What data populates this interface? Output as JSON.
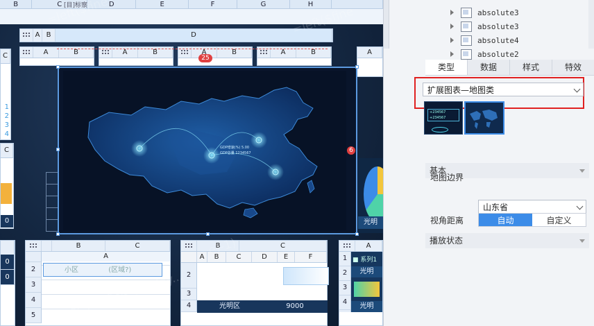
{
  "sheet": {
    "top_columns": [
      "B",
      "C",
      "D",
      "E",
      "F",
      "G",
      "H",
      ""
    ],
    "top_cell_text": "[目]标察",
    "formula_watermark_1": "=left($fine",
    "formula_watermark_2": "=left($fine",
    "formula_watermark_3": "=left($fine_",
    "formula_watermark_4": "e.find(\"[\",$fine_display...",
    "formula_watermark_5": "e)-1)",
    "formula_watermark_6": "display",
    "ab_header": [
      "A",
      "B"
    ],
    "d_header": "D",
    "mini_headers": [
      [
        "A",
        "B"
      ],
      [
        "A",
        "B"
      ],
      [
        "A",
        "B"
      ],
      [
        "A",
        "B"
      ]
    ],
    "badge_25": "25",
    "badge_6": "6",
    "left_col_c": "C",
    "left_rows": [
      "1",
      "2",
      "3",
      "4"
    ],
    "left_col_c2": "C",
    "left_val_0": "0",
    "side_right_a": "A",
    "bottom_left_rows": [
      "2",
      "3",
      "4",
      "5"
    ],
    "bottom_left_vals": [
      "0",
      "0"
    ],
    "sheet2": {
      "cols": [
        "A",
        "B",
        "C"
      ],
      "rows": [
        "2",
        "3",
        "4",
        "5"
      ],
      "cell_text": "小区",
      "cell_text_2": "(区域?)"
    },
    "sheet3": {
      "cols_top": [
        "B",
        "C"
      ],
      "cols": [
        "A",
        "B",
        "C",
        "D",
        "E",
        "F"
      ],
      "rows": [
        "2",
        "3",
        "4"
      ],
      "bottom_label": "光明区",
      "bottom_value": "9000"
    },
    "sheet4": {
      "cols": [
        "A"
      ],
      "rows": [
        "1",
        "2",
        "3",
        "4"
      ],
      "legend": "系列1",
      "label": "光明",
      "label2": "光明"
    },
    "right_edge_text": "光明"
  },
  "map_widget": {
    "title": "扩展图表—地图类",
    "popup_line1": "GDP增速(%) 5.00",
    "popup_line2": "GDP总量 1234567"
  },
  "panel": {
    "tree_items": [
      "absolute3",
      "absolute3",
      "absolute4",
      "absolute2"
    ],
    "tabs": [
      "类型",
      "数据",
      "样式",
      "特效"
    ],
    "active_tab": "类型",
    "chart_type_value": "扩展图表—地图类",
    "thumb1_line1": "+234567",
    "thumb1_line2": "+234567",
    "section_basic": "基本",
    "map_border_label": "地图边界",
    "map_border_value": "山东省",
    "section_play": "播放状态",
    "view_distance_label": "视角距离",
    "view_distance_options": [
      "自动",
      "自定义"
    ],
    "highlight_color": "#e02020",
    "accent_color": "#3c8ce8"
  }
}
